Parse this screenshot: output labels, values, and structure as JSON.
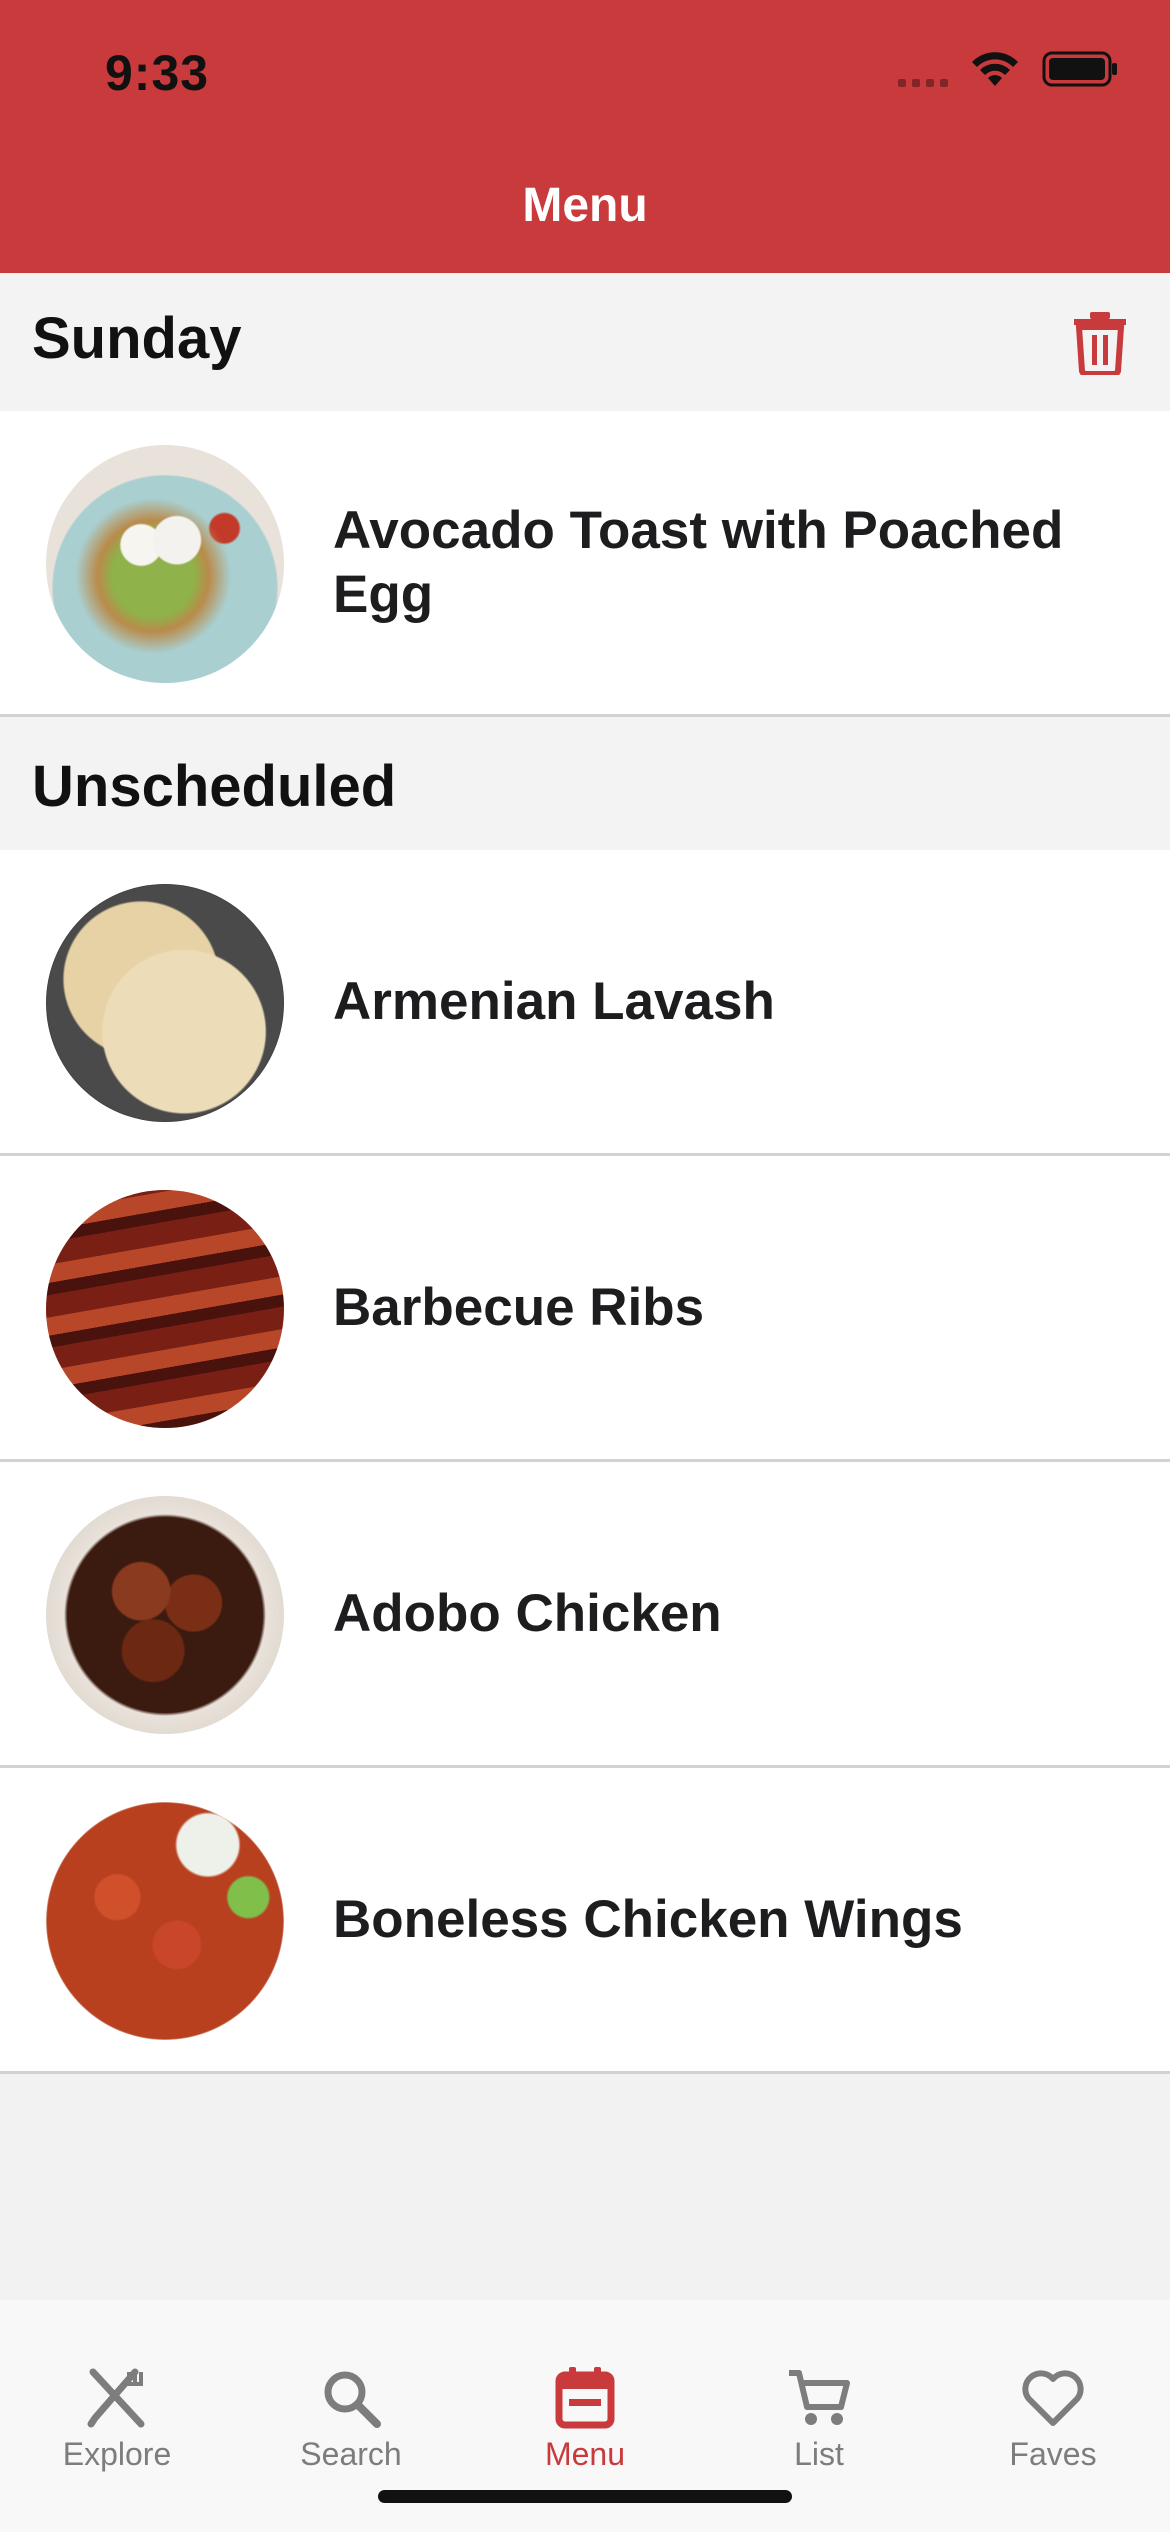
{
  "status_bar": {
    "time": "9:33"
  },
  "nav": {
    "title": "Menu"
  },
  "colors": {
    "brand": "#c83a3b",
    "tab_inactive": "#7d7d7d"
  },
  "sections": [
    {
      "title": "Sunday",
      "action_icon": "trash-icon",
      "items": [
        {
          "title": "Avocado Toast with Poached Egg",
          "image": "avocado-toast-photo"
        }
      ]
    },
    {
      "title": "Unscheduled",
      "items": [
        {
          "title": "Armenian Lavash",
          "image": "lavash-photo"
        },
        {
          "title": "Barbecue Ribs",
          "image": "ribs-photo"
        },
        {
          "title": "Adobo Chicken",
          "image": "adobo-chicken-photo"
        },
        {
          "title": "Boneless Chicken Wings",
          "image": "chicken-wings-photo"
        }
      ]
    }
  ],
  "tabs": [
    {
      "label": "Explore",
      "icon": "fork-knife-icon",
      "active": false
    },
    {
      "label": "Search",
      "icon": "search-icon",
      "active": false
    },
    {
      "label": "Menu",
      "icon": "calendar-icon",
      "active": true
    },
    {
      "label": "List",
      "icon": "cart-icon",
      "active": false
    },
    {
      "label": "Faves",
      "icon": "heart-icon",
      "active": false
    }
  ]
}
